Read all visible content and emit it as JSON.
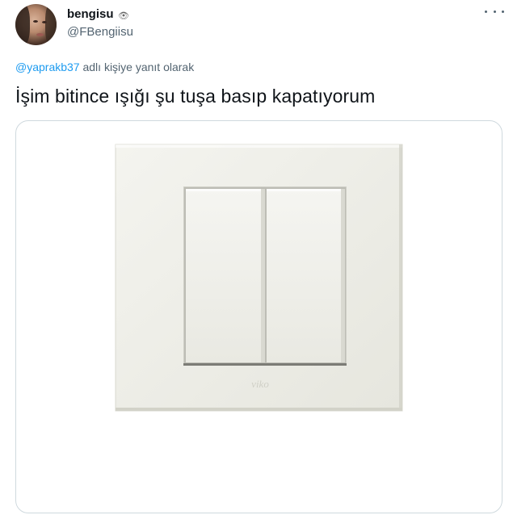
{
  "tweet": {
    "display_name": "bengisu",
    "name_emoji": "👁",
    "handle": "@FBengiisu",
    "reply_to_mention": "@yaprakb37",
    "reply_to_suffix": " adlı kişiye yanıt olarak",
    "text": "İşim bitince ışığı şu tuşa basıp kapatıyorum",
    "media": {
      "subject": "double light switch",
      "brand_mark": "viko"
    }
  },
  "icons": {
    "more": "more-horizontal-icon",
    "verified_eye": "eye-icon"
  },
  "colors": {
    "text_primary": "#0f1419",
    "text_secondary": "#536471",
    "link": "#1d9bf0",
    "border": "#cfd9de"
  }
}
